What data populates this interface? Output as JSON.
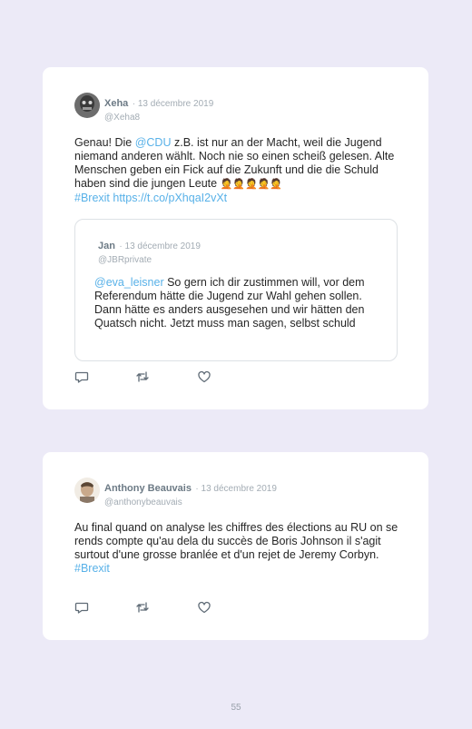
{
  "tweets": [
    {
      "author": "Xeha",
      "date": "· 13 décembre 2019",
      "handle": "@Xeha8",
      "text_1": "Genau! Die ",
      "mention_1": "@CDU",
      "text_2": " z.B. ist nur an der Macht, weil die Jugend niemand anderen wählt. Noch nie so einen scheiß gelesen. Alte Menschen geben ein Fick auf die Zukunft und die die Schuld haben sind die jungen Leute ",
      "emoji": "🤦🤦🤦🤦🤦",
      "hashtag": "#Brexit",
      "url": " https://t.co/pXhqaI2vXt",
      "quoted": {
        "author": "Jan",
        "date": "· 13 décembre 2019",
        "handle": "@JBRprivate",
        "mention": "@eva_leisner",
        "text": " So gern ich dir zustimmen will, vor dem Referendum hätte die Jugend zur Wahl gehen sollen. Dann hätte es anders ausgesehen und wir hätten den Quatsch nicht. Jetzt muss man sagen, selbst schuld"
      }
    },
    {
      "author": "Anthony Beauvais",
      "date": "· 13 décembre 2019",
      "handle": "@anthonybeauvais",
      "text_1": "Au final quand on analyse les chiffres des élections au RU on se rends compte qu'au dela du succès de Boris Johnson il s'agit surtout d'une grosse branlée et d'un rejet de Jeremy Corbyn. ",
      "hashtag": "#Brexit"
    }
  ],
  "icons": {
    "reply": "reply-icon",
    "retweet": "retweet-icon",
    "like": "heart-icon"
  },
  "colors": {
    "link": "#58b1e8",
    "background": "#eceaf7"
  },
  "page_number": "55"
}
